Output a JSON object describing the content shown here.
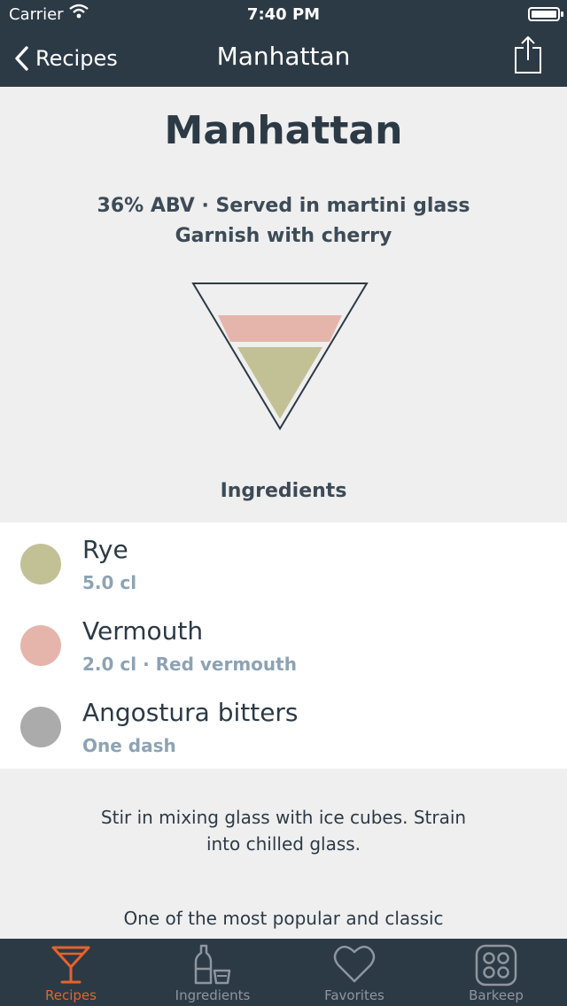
{
  "status_bar": {
    "carrier": "Carrier",
    "time": "7:40 PM"
  },
  "nav": {
    "back_label": "Recipes",
    "title": "Manhattan"
  },
  "recipe": {
    "title": "Manhattan",
    "meta_line1": "36% ABV · Served in martini glass",
    "meta_line2": "Garnish with cherry",
    "ingredients_heading": "Ingredients",
    "ingredients": [
      {
        "name": "Rye",
        "detail": "5.0 cl",
        "color": "#c2c196"
      },
      {
        "name": "Vermouth",
        "detail": "2.0 cl · Red vermouth",
        "color": "#e5b5ac"
      },
      {
        "name": "Angostura bitters",
        "detail": "One dash",
        "color": "#ababab"
      }
    ],
    "instructions": "Stir in mixing glass with ice cubes. Strain into chilled glass.",
    "description": "One of the most popular and classic"
  },
  "glass_colors": {
    "top": "#e5b5ac",
    "bottom": "#c2c196"
  },
  "tabs": [
    {
      "label": "Recipes",
      "icon": "martini-icon",
      "active": true
    },
    {
      "label": "Ingredients",
      "icon": "bottle-glass-icon",
      "active": false
    },
    {
      "label": "Favorites",
      "icon": "heart-icon",
      "active": false
    },
    {
      "label": "Barkeep",
      "icon": "grid-dots-icon",
      "active": false
    }
  ],
  "colors": {
    "accent": "#e8622a",
    "nav_bg": "#2c3a46",
    "tab_inactive": "#8e969d"
  }
}
